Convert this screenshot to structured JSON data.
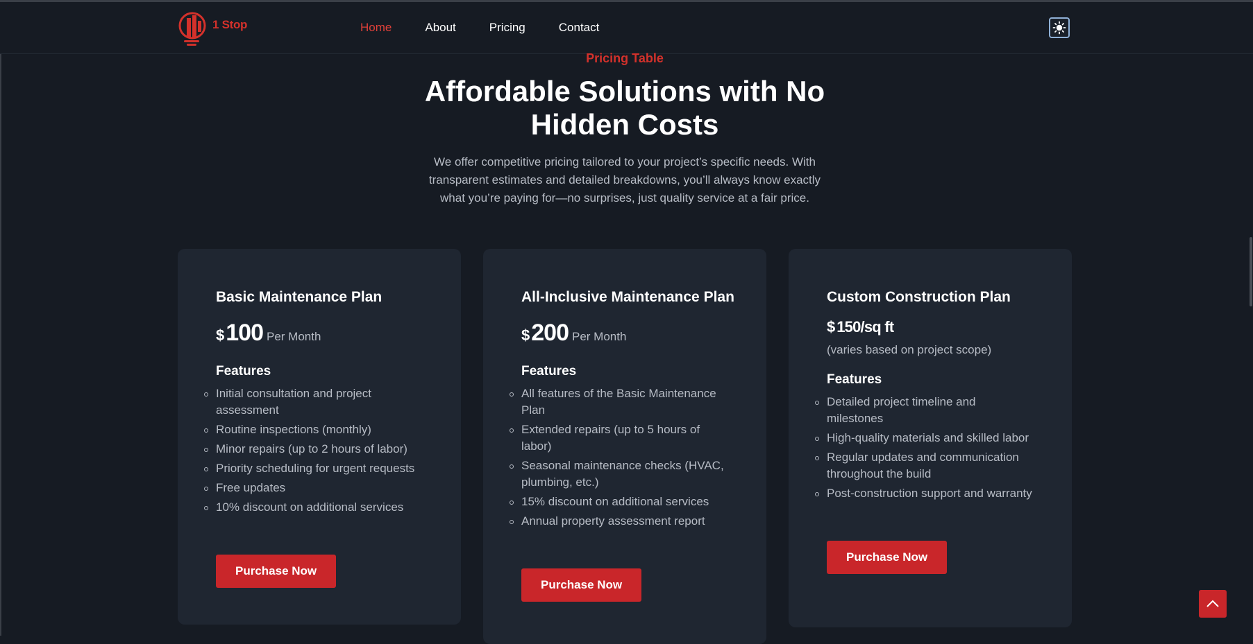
{
  "brand": {
    "name": "1 Stop",
    "color": "#d3312b"
  },
  "nav": {
    "items": [
      {
        "label": "Home",
        "active": true
      },
      {
        "label": "About",
        "active": false
      },
      {
        "label": "Pricing",
        "active": false
      },
      {
        "label": "Contact",
        "active": false
      }
    ]
  },
  "theme_toggle": {
    "icon": "sun-icon"
  },
  "hero": {
    "eyebrow": "Pricing Table",
    "headline": "Affordable Solutions with No Hidden Costs",
    "intro": "We offer competitive pricing tailored to your project’s specific needs. With transparent estimates and detailed breakdowns, you’ll always know exactly what you’re paying for—no surprises, just quality service at a fair price."
  },
  "plans": [
    {
      "title": "Basic Maintenance Plan",
      "currency": "$",
      "amount": "100",
      "period": "Per Month",
      "features_title": "Features",
      "features": [
        "Initial consultation and project assessment",
        "Routine inspections (monthly)",
        "Minor repairs (up to 2 hours of labor)",
        "Priority scheduling for urgent requests",
        "Free updates",
        "10% discount on additional services"
      ],
      "button": "Purchase Now"
    },
    {
      "title": "All-Inclusive Maintenance Plan",
      "currency": "$",
      "amount": "200",
      "period": "Per Month",
      "features_title": "Features",
      "features": [
        "All features of the Basic Maintenance Plan",
        "Extended repairs (up to 5 hours of labor)",
        "Seasonal maintenance checks (HVAC, plumbing, etc.)",
        "15% discount on additional services",
        "Annual property assessment report"
      ],
      "button": "Purchase Now"
    },
    {
      "title": "Custom Construction Plan",
      "currency": "$",
      "amount": "150/sq ft",
      "note": "(varies based on project scope)",
      "features_title": "Features",
      "features": [
        "Detailed project timeline and milestones",
        "High-quality materials and skilled labor",
        "Regular updates and communication throughout the build",
        "Post-construction support and warranty"
      ],
      "button": "Purchase Now"
    }
  ],
  "colors": {
    "accent": "#c9262a",
    "background": "#161b23",
    "card": "#1f2631"
  }
}
